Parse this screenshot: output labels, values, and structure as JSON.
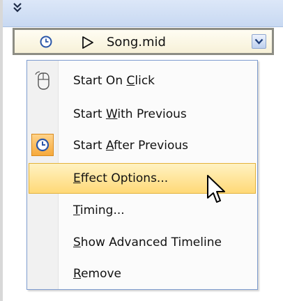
{
  "header": {
    "collapse_icon": "double-chevron-down-icon",
    "collapse_glyph": "»"
  },
  "animation_item": {
    "label": "Song.mid",
    "trigger_icon": "clock-icon",
    "effect_icon": "play-triangle-icon",
    "dropdown_icon": "chevron-down-icon"
  },
  "menu": {
    "items": [
      {
        "name": "start-on-click",
        "pre": "Start On ",
        "key": "C",
        "post": "lick",
        "icon": "mouse-icon",
        "checked": false,
        "highlighted": false
      },
      {
        "name": "start-with-previous",
        "pre": "Start ",
        "key": "W",
        "post": "ith Previous",
        "icon": "",
        "checked": false,
        "highlighted": false
      },
      {
        "name": "start-after-previous",
        "pre": "Start ",
        "key": "A",
        "post": "fter Previous",
        "icon": "clock-icon",
        "checked": true,
        "highlighted": false
      },
      {
        "name": "effect-options",
        "pre": "",
        "key": "E",
        "post": "ffect Options...",
        "icon": "",
        "checked": false,
        "highlighted": true
      },
      {
        "name": "timing",
        "pre": "",
        "key": "T",
        "post": "iming...",
        "icon": "",
        "checked": false,
        "highlighted": false
      },
      {
        "name": "show-advanced-timeline",
        "pre": "",
        "key": "S",
        "post": "how Advanced Timeline",
        "icon": "",
        "checked": false,
        "highlighted": false
      },
      {
        "name": "remove",
        "pre": "",
        "key": "R",
        "post": "emove",
        "icon": "",
        "checked": false,
        "highlighted": false
      }
    ]
  },
  "colors": {
    "header_bg": "#c8d9f2",
    "highlight": "#ffd977",
    "checked_bg": "#f6a93b",
    "menu_border": "#7e9ccf"
  },
  "cursor_icon": "arrow-cursor-icon"
}
